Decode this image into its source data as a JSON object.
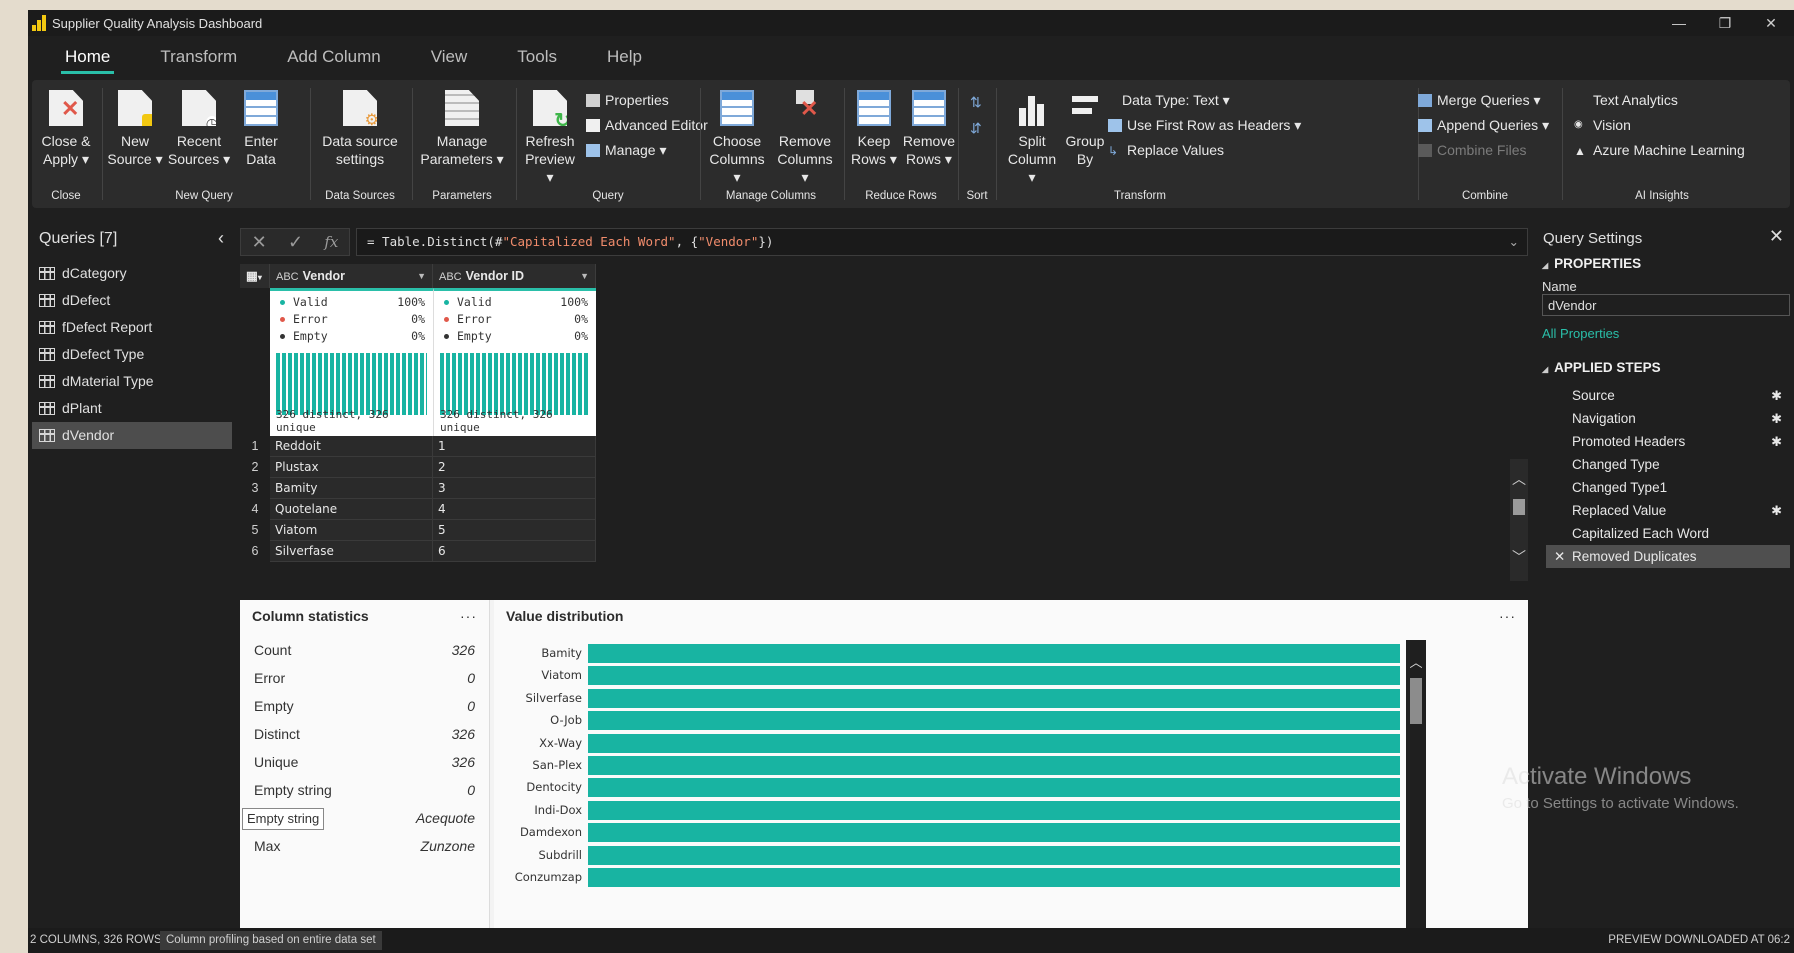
{
  "window": {
    "title": "Supplier Quality Analysis Dashboard",
    "minimize": "—",
    "restore": "❐",
    "close": "✕"
  },
  "menu": [
    "Home",
    "Transform",
    "Add Column",
    "View",
    "Tools",
    "Help"
  ],
  "ribbon": {
    "close_apply": "Close &",
    "close_apply2": "Apply ▾",
    "g_close": "Close",
    "new_source": "New",
    "new_source2": "Source ▾",
    "recent_sources": "Recent",
    "recent_sources2": "Sources ▾",
    "enter_data": "Enter",
    "enter_data2": "Data",
    "g_new_query": "New Query",
    "ds_settings": "Data source",
    "ds_settings2": "settings",
    "g_data_sources": "Data Sources",
    "manage_params": "Manage",
    "manage_params2": "Parameters ▾",
    "g_parameters": "Parameters",
    "refresh": "Refresh",
    "refresh2": "Preview ▾",
    "properties": "Properties",
    "advanced_editor": "Advanced Editor",
    "manage": "Manage ▾",
    "g_query": "Query",
    "choose_cols": "Choose",
    "choose_cols2": "Columns ▾",
    "remove_cols": "Remove",
    "remove_cols2": "Columns ▾",
    "g_manage_columns": "Manage Columns",
    "keep_rows": "Keep",
    "keep_rows2": "Rows ▾",
    "remove_rows": "Remove",
    "remove_rows2": "Rows ▾",
    "g_reduce_rows": "Reduce Rows",
    "g_sort": "Sort",
    "split_col": "Split",
    "split_col2": "Column ▾",
    "group_by": "Group",
    "group_by2": "By",
    "data_type": "Data Type: Text ▾",
    "first_row_headers": "Use First Row as Headers ▾",
    "replace_values": "Replace Values",
    "g_transform": "Transform",
    "merge_queries": "Merge Queries ▾",
    "append_queries": "Append Queries ▾",
    "combine_files": "Combine Files",
    "g_combine": "Combine",
    "text_analytics": "Text Analytics",
    "vision": "Vision",
    "azure_ml": "Azure Machine Learning",
    "g_ai": "AI Insights"
  },
  "queries": {
    "title": "Queries [7]",
    "items": [
      "dCategory",
      "dDefect",
      "fDefect Report",
      "dDefect Type",
      "dMaterial Type",
      "dPlant",
      "dVendor"
    ],
    "selected": "dVendor"
  },
  "formula": {
    "prefix": "= Table.Distinct(#",
    "s1": "\"Capitalized Each Word\"",
    "mid": ", {",
    "s2": "\"Vendor\"",
    "suffix": "})"
  },
  "grid": {
    "columns": [
      {
        "name": "Vendor",
        "type": "ABC",
        "valid": "100%",
        "error": "0%",
        "empty": "0%",
        "footer": "326 distinct, 326 unique"
      },
      {
        "name": "Vendor ID",
        "type": "ABC",
        "valid": "100%",
        "error": "0%",
        "empty": "0%",
        "footer": "326 distinct, 326 unique"
      }
    ],
    "labels": {
      "valid": "Valid",
      "error": "Error",
      "empty": "Empty"
    },
    "rows": [
      [
        "1",
        "Reddoit",
        "1"
      ],
      [
        "2",
        "Plustax",
        "2"
      ],
      [
        "3",
        "Bamity",
        "3"
      ],
      [
        "4",
        "Quotelane",
        "4"
      ],
      [
        "5",
        "Viatom",
        "5"
      ],
      [
        "6",
        "Silverfase",
        "6"
      ]
    ]
  },
  "column_stats": {
    "title": "Column statistics",
    "more": "···",
    "rows": [
      {
        "label": "Count",
        "value": "326"
      },
      {
        "label": "Error",
        "value": "0"
      },
      {
        "label": "Empty",
        "value": "0"
      },
      {
        "label": "Distinct",
        "value": "326"
      },
      {
        "label": "Unique",
        "value": "326"
      },
      {
        "label": "Empty string",
        "value": "0"
      },
      {
        "label": "Empty string",
        "value": "Acequote"
      },
      {
        "label": "Max",
        "value": "Zunzone"
      }
    ]
  },
  "value_distribution": {
    "title": "Value distribution",
    "more": "···",
    "items": [
      "Bamity",
      "Viatom",
      "Silverfase",
      "O-Job",
      "Xx-Way",
      "San-Plex",
      "Dentocity",
      "Indi-Dox",
      "Damdexon",
      "Subdrill",
      "Conzumzap"
    ],
    "values": [
      1,
      1,
      1,
      1,
      1,
      1,
      1,
      1,
      1,
      1,
      1
    ]
  },
  "settings": {
    "title": "Query Settings",
    "properties": "PROPERTIES",
    "name_label": "Name",
    "name_value": "dVendor",
    "all_properties": "All Properties",
    "applied_steps": "APPLIED STEPS",
    "steps": [
      {
        "label": "Source",
        "gear": true
      },
      {
        "label": "Navigation",
        "gear": true
      },
      {
        "label": "Promoted Headers",
        "gear": true
      },
      {
        "label": "Changed Type",
        "gear": false
      },
      {
        "label": "Changed Type1",
        "gear": false
      },
      {
        "label": "Replaced Value",
        "gear": true
      },
      {
        "label": "Capitalized Each Word",
        "gear": false
      },
      {
        "label": "Removed Duplicates",
        "gear": false
      }
    ]
  },
  "watermark": {
    "line1": "Activate Windows",
    "line2": "Go to Settings to activate Windows."
  },
  "status": {
    "left": "2 COLUMNS, 326 ROWS",
    "profiling": "Column profiling based on entire data set",
    "right": "PREVIEW DOWNLOADED AT 06:2"
  }
}
